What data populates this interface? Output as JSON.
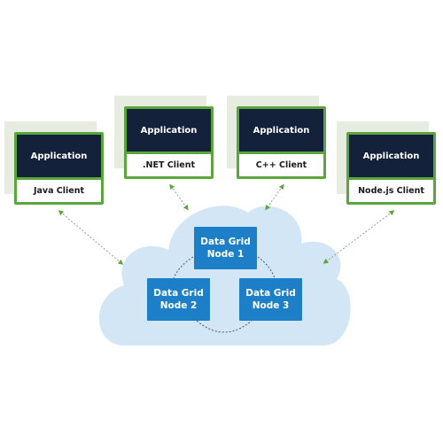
{
  "colors": {
    "client_border": "#5aa63c",
    "application_bg": "#14213a",
    "shadow": "#e6ece0",
    "cloud": "#d2e6f5",
    "node_bg": "#1d7fc8",
    "arrow": "#7a9a80"
  },
  "clients": [
    {
      "app_label": "Application",
      "client_label": "Java Client"
    },
    {
      "app_label": "Application",
      "client_label": ".NET Client"
    },
    {
      "app_label": "Application",
      "client_label": "C++ Client"
    },
    {
      "app_label": "Application",
      "client_label": "Node.js Client"
    }
  ],
  "cloud": {
    "nodes": [
      {
        "line1": "Data Grid",
        "line2": "Node 1"
      },
      {
        "line1": "Data Grid",
        "line2": "Node 2"
      },
      {
        "line1": "Data Grid",
        "line2": "Node 3"
      }
    ]
  },
  "connections": [
    {
      "from": "Java Client",
      "to": "cloud",
      "style": "dotted-bidirectional"
    },
    {
      "from": ".NET Client",
      "to": "cloud",
      "style": "dotted-bidirectional"
    },
    {
      "from": "C++ Client",
      "to": "cloud",
      "style": "dotted-bidirectional"
    },
    {
      "from": "Node.js Client",
      "to": "cloud",
      "style": "dotted-bidirectional"
    },
    {
      "from": "Node 1",
      "to": "Node 2",
      "style": "dashed-arc"
    },
    {
      "from": "Node 1",
      "to": "Node 3",
      "style": "dashed-arc"
    },
    {
      "from": "Node 2",
      "to": "Node 3",
      "style": "dashed-arc"
    }
  ]
}
